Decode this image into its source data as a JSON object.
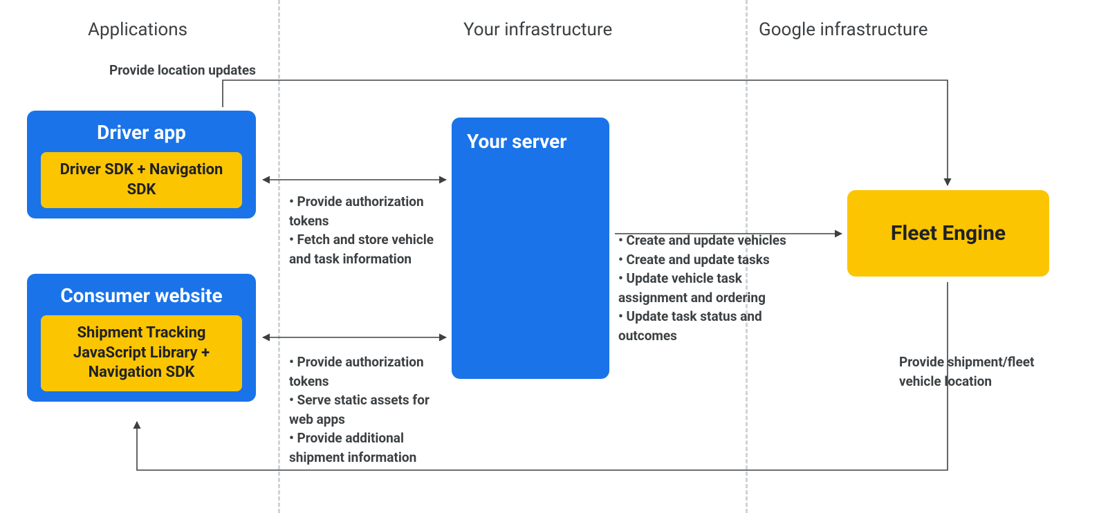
{
  "sections": {
    "applications": "Applications",
    "your_infra": "Your infrastructure",
    "google_infra": "Google infrastructure"
  },
  "driver_app": {
    "title": "Driver app",
    "chip": "Driver SDK + Navigation SDK"
  },
  "consumer_site": {
    "title": "Consumer website",
    "chip": "Shipment Tracking JavaScript Library  + Navigation SDK"
  },
  "your_server": {
    "title": "Your server"
  },
  "fleet_engine": {
    "title": "Fleet Engine"
  },
  "labels": {
    "provide_location_updates": "Provide location updates",
    "driver_server_b1": "• Provide authorization tokens",
    "driver_server_b2": "• Fetch and store vehicle and task information",
    "consumer_server_b1": "• Provide authorization tokens",
    "consumer_server_b2": "• Serve static assets for web apps",
    "consumer_server_b3": "• Provide additional shipment information",
    "server_fleet_b1": "• Create and update vehicles",
    "server_fleet_b2": "• Create and update tasks",
    "server_fleet_b3": "• Update vehicle task assignment and ordering",
    "server_fleet_b4": "• Update task status and outcomes",
    "fleet_to_consumer": "Provide shipment/fleet vehicle location"
  },
  "colors": {
    "blue": "#1a73e8",
    "yellow": "#fbc502",
    "text": "#3c4043"
  }
}
